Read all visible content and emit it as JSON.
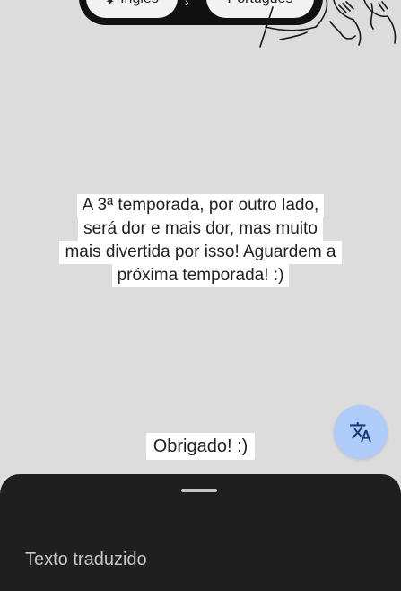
{
  "language_bar": {
    "source_language": "Inglês",
    "target_language": "Português",
    "source_icon": "sparkle-icon",
    "swap_icon": "arrow-right-icon"
  },
  "overlay": {
    "main_lines": [
      "A 3ª temporada, por outro lado,",
      "será dor e mais dor, mas muito",
      "mais divertida por isso! Aguardem a",
      "próxima temporada! :)"
    ],
    "thanks_line": "Obrigado! :)"
  },
  "fab": {
    "icon": "translate-icon",
    "color": "#aecbfa"
  },
  "bottom_sheet": {
    "title": "Texto traduzido",
    "background": "#1f1f1f"
  }
}
